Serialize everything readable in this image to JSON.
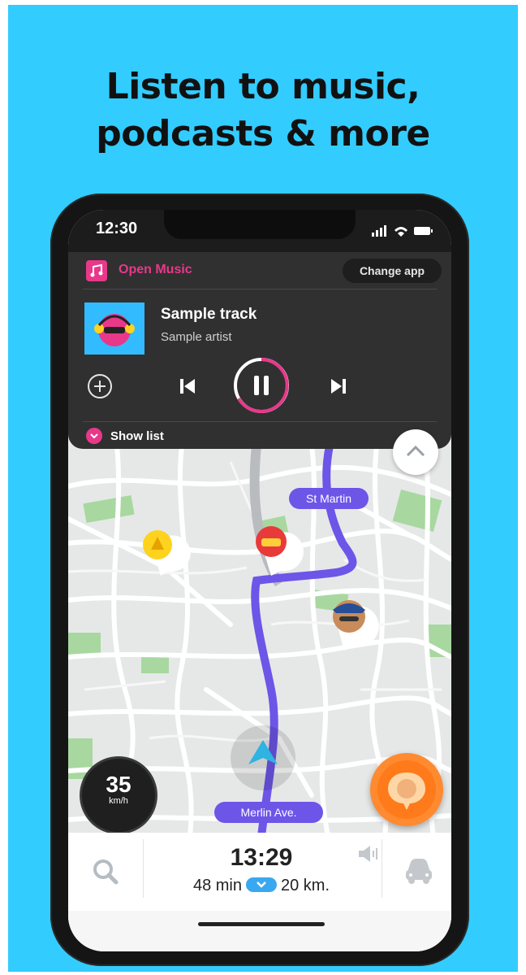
{
  "headline": {
    "line1": "Listen to music,",
    "line2": "podcasts & more"
  },
  "status": {
    "time": "12:30"
  },
  "player": {
    "open_label": "Open Music",
    "change_app_label": "Change app",
    "track_title": "Sample track",
    "track_artist": "Sample artist",
    "show_list_label": "Show list",
    "accent_color": "#e8388a"
  },
  "map": {
    "street_top": "St Martin",
    "street_bottom": "Merlin Ave.",
    "route_color": "#6d55e8"
  },
  "speedometer": {
    "value": "35",
    "unit": "km/h"
  },
  "trip": {
    "eta": "13:29",
    "duration": "48 min",
    "distance": "20 km."
  },
  "icons": [
    "music-note-icon",
    "add-icon",
    "previous-icon",
    "pause-icon",
    "next-icon",
    "chevron-down-icon",
    "chevron-up-icon",
    "hazard-icon",
    "traffic-icon",
    "police-icon",
    "navigation-arrow-icon",
    "report-icon",
    "search-icon",
    "speaker-icon",
    "car-icon"
  ]
}
